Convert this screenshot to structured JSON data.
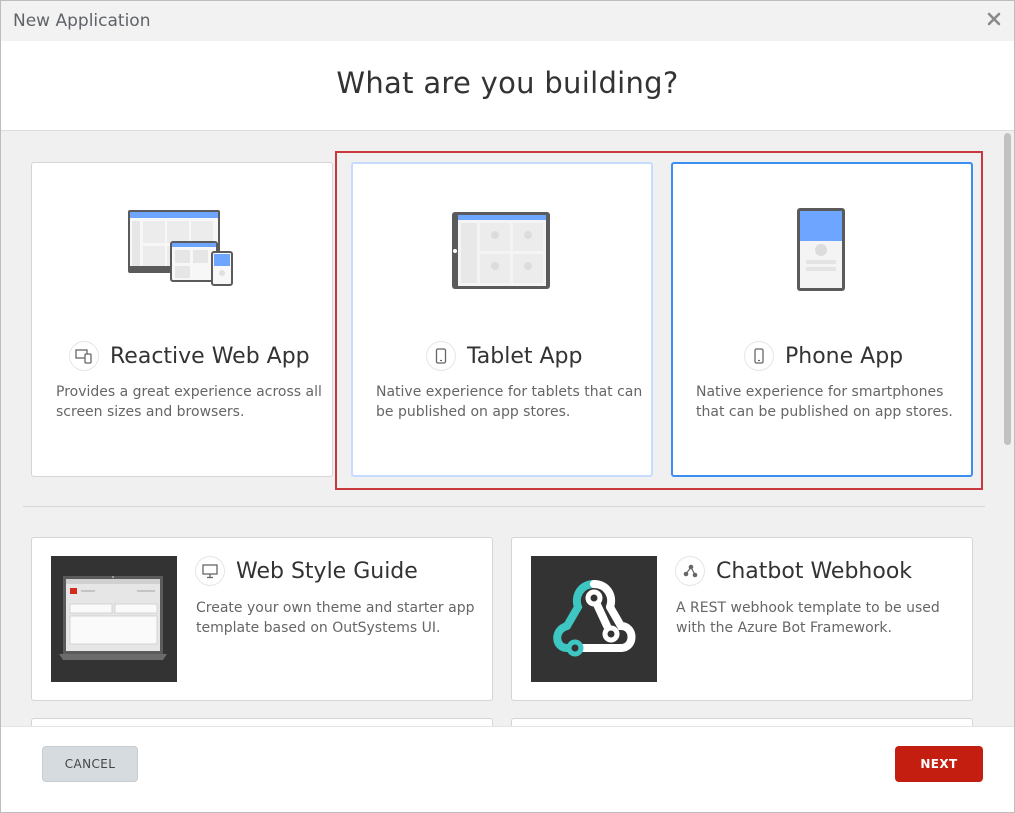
{
  "dialog": {
    "title": "New Application",
    "heading": "What are you building?"
  },
  "cards": {
    "reactive": {
      "title": "Reactive Web App",
      "line1": "Provides a great experience across all",
      "line2": "screen sizes and browsers."
    },
    "tablet": {
      "title": "Tablet App",
      "line1": "Native experience for tablets that can",
      "line2": "be published on app stores."
    },
    "phone": {
      "title": "Phone App",
      "line1": "Native experience for smartphones",
      "line2": "that can be published on app stores."
    },
    "styleguide": {
      "title": "Web Style Guide",
      "line1": "Create your own theme and starter app",
      "line2": "template based on OutSystems UI."
    },
    "chatbot": {
      "title": "Chatbot Webhook",
      "line1": "A REST webhook template to be used",
      "line2": "with the Azure Bot Framework."
    }
  },
  "footer": {
    "cancel": "CANCEL",
    "next": "NEXT"
  },
  "colors": {
    "accent_blue": "#3b8ff0",
    "selection_highlight": "#c9383c",
    "next_button": "#c41e10"
  }
}
